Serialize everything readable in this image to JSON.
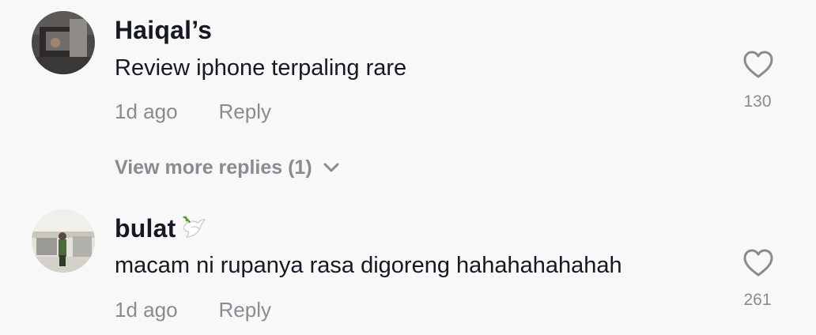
{
  "comments": [
    {
      "username": "Haiqal’s",
      "text": "Review iphone terpaling rare",
      "time": "1d ago",
      "reply_label": "Reply",
      "likes": "130",
      "avatar_icon": "user-avatar-photo"
    },
    {
      "username": "bulat",
      "username_emoji": "dove-emoji",
      "text": "macam ni rupanya rasa digoreng hahahahahahah",
      "time": "1d ago",
      "reply_label": "Reply",
      "likes": "261",
      "avatar_icon": "user-avatar-photo"
    }
  ],
  "view_more_replies": "View more replies (1)",
  "colors": {
    "background": "#f8f8f8",
    "primary_text": "#161823",
    "secondary_text": "#8a8b91"
  }
}
